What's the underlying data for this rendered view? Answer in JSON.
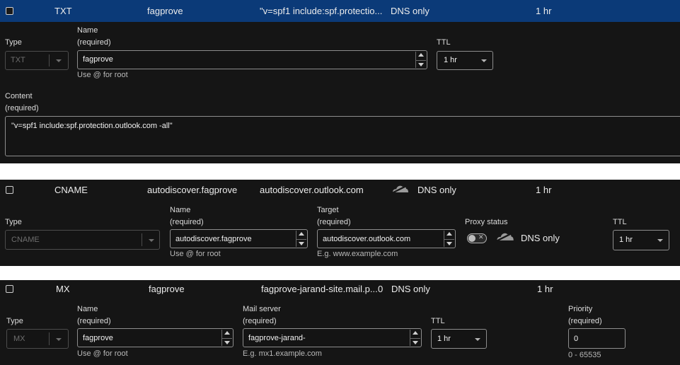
{
  "records": {
    "txt": {
      "type": "TXT",
      "name": "fagprove",
      "content_preview": "\"v=spf1 include:spf.protectio...",
      "proxy": "DNS only",
      "ttl": "1 hr",
      "form": {
        "type_label": "Type",
        "type_value": "TXT",
        "name_label": "Name",
        "name_required": "(required)",
        "name_value": "fagprove",
        "name_hint": "Use @ for root",
        "ttl_label": "TTL",
        "ttl_value": "1 hr",
        "content_label": "Content",
        "content_required": "(required)",
        "content_value": "\"v=spf1 include:spf.protection.outlook.com -all\""
      }
    },
    "cname": {
      "type": "CNAME",
      "name": "autodiscover.fagprove",
      "content": "autodiscover.outlook.com",
      "proxy": "DNS only",
      "ttl": "1 hr",
      "form": {
        "type_label": "Type",
        "type_value": "CNAME",
        "name_label": "Name",
        "name_required": "(required)",
        "name_value": "autodiscover.fagprove",
        "name_hint": "Use @ for root",
        "target_label": "Target",
        "target_required": "(required)",
        "target_value": "autodiscover.outlook.com",
        "target_hint": "E.g. www.example.com",
        "proxy_label": "Proxy status",
        "proxy_value": "DNS only",
        "ttl_label": "TTL",
        "ttl_value": "1 hr"
      }
    },
    "mx": {
      "type": "MX",
      "name": "fagprove",
      "content": "fagprove-jarand-site.mail.p...",
      "priority": "0",
      "proxy": "DNS only",
      "ttl": "1 hr",
      "form": {
        "type_label": "Type",
        "type_value": "MX",
        "name_label": "Name",
        "name_required": "(required)",
        "name_value": "fagprove",
        "name_hint": "Use @ for root",
        "mail_label": "Mail server",
        "mail_required": "(required)",
        "mail_value": "fagprove-jarand-",
        "mail_hint": "E.g. mx1.example.com",
        "ttl_label": "TTL",
        "ttl_value": "1 hr",
        "priority_label": "Priority",
        "priority_required": "(required)",
        "priority_value": "0",
        "priority_hint": "0 - 65535"
      }
    }
  },
  "colors": {
    "selected_row": "#0b3a78",
    "panel_bg": "#151515",
    "page_bg": "#ffffff"
  },
  "icons": [
    "cloud-icon",
    "chevron-down-icon",
    "spinner-icon",
    "toggle-icon"
  ]
}
